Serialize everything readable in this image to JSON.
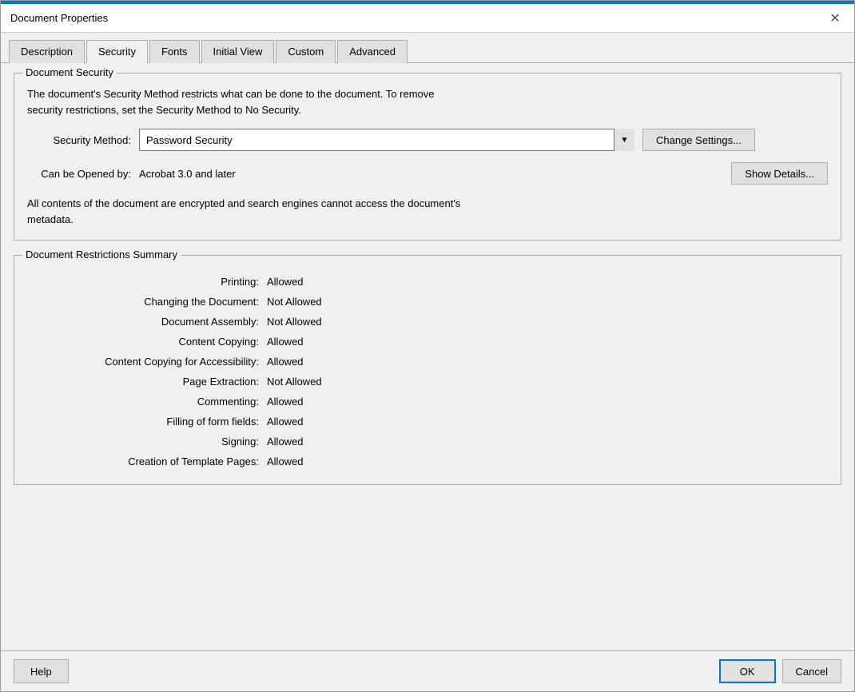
{
  "window": {
    "title": "Document Properties"
  },
  "tabs": [
    {
      "label": "Description",
      "active": false
    },
    {
      "label": "Security",
      "active": true
    },
    {
      "label": "Fonts",
      "active": false
    },
    {
      "label": "Initial View",
      "active": false
    },
    {
      "label": "Custom",
      "active": false
    },
    {
      "label": "Advanced",
      "active": false
    }
  ],
  "document_security": {
    "group_title": "Document Security",
    "description_line1": "The document's Security Method restricts what can be done to the document. To remove",
    "description_line2": "security restrictions, set the Security Method to No Security.",
    "security_method_label": "Security Method:",
    "security_method_value": "Password Security",
    "change_settings_button": "Change Settings...",
    "can_opened_label": "Can be Opened by:",
    "can_opened_value": "Acrobat 3.0 and later",
    "show_details_button": "Show Details...",
    "encryption_note": "All contents of the document are encrypted and search engines cannot access the document's\nmetadata."
  },
  "restrictions": {
    "group_title": "Document Restrictions Summary",
    "items": [
      {
        "label": "Printing:",
        "value": "Allowed"
      },
      {
        "label": "Changing the Document:",
        "value": "Not Allowed"
      },
      {
        "label": "Document Assembly:",
        "value": "Not Allowed"
      },
      {
        "label": "Content Copying:",
        "value": "Allowed"
      },
      {
        "label": "Content Copying for Accessibility:",
        "value": "Allowed"
      },
      {
        "label": "Page Extraction:",
        "value": "Not Allowed"
      },
      {
        "label": "Commenting:",
        "value": "Allowed"
      },
      {
        "label": "Filling of form fields:",
        "value": "Allowed"
      },
      {
        "label": "Signing:",
        "value": "Allowed"
      },
      {
        "label": "Creation of Template Pages:",
        "value": "Allowed"
      }
    ]
  },
  "buttons": {
    "help": "Help",
    "ok": "OK",
    "cancel": "Cancel"
  }
}
